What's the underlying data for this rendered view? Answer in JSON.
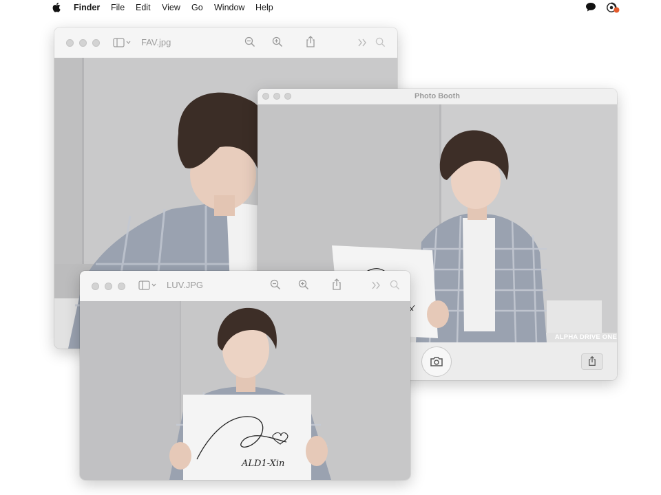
{
  "menubar": {
    "app_name": "Finder",
    "items": [
      "File",
      "Edit",
      "View",
      "Go",
      "Window",
      "Help"
    ],
    "status_icons": [
      "message-bubble-icon",
      "control-center-icon"
    ]
  },
  "window_fav": {
    "title": "FAV.jpg",
    "toolbar_icons": [
      "sidebar-toggle-icon",
      "zoom-out-icon",
      "zoom-in-icon",
      "share-icon",
      "more-chevrons-icon",
      "search-icon"
    ]
  },
  "window_photobooth": {
    "title": "Photo Booth",
    "watermark": "ALPHA DRIVE ONE",
    "buttons": [
      "camera-shutter-button",
      "share-button"
    ]
  },
  "window_luv": {
    "title": "LUV.JPG",
    "signature_text": "ALD1-Xin",
    "toolbar_icons": [
      "sidebar-toggle-icon",
      "zoom-out-icon",
      "zoom-in-icon",
      "share-icon",
      "more-chevrons-icon",
      "search-icon"
    ]
  },
  "colors": {
    "wall": "#cfcfd0",
    "shirt_check": "#8e97a6",
    "hair": "#3a2c25",
    "skin": "#e9cdbd"
  }
}
